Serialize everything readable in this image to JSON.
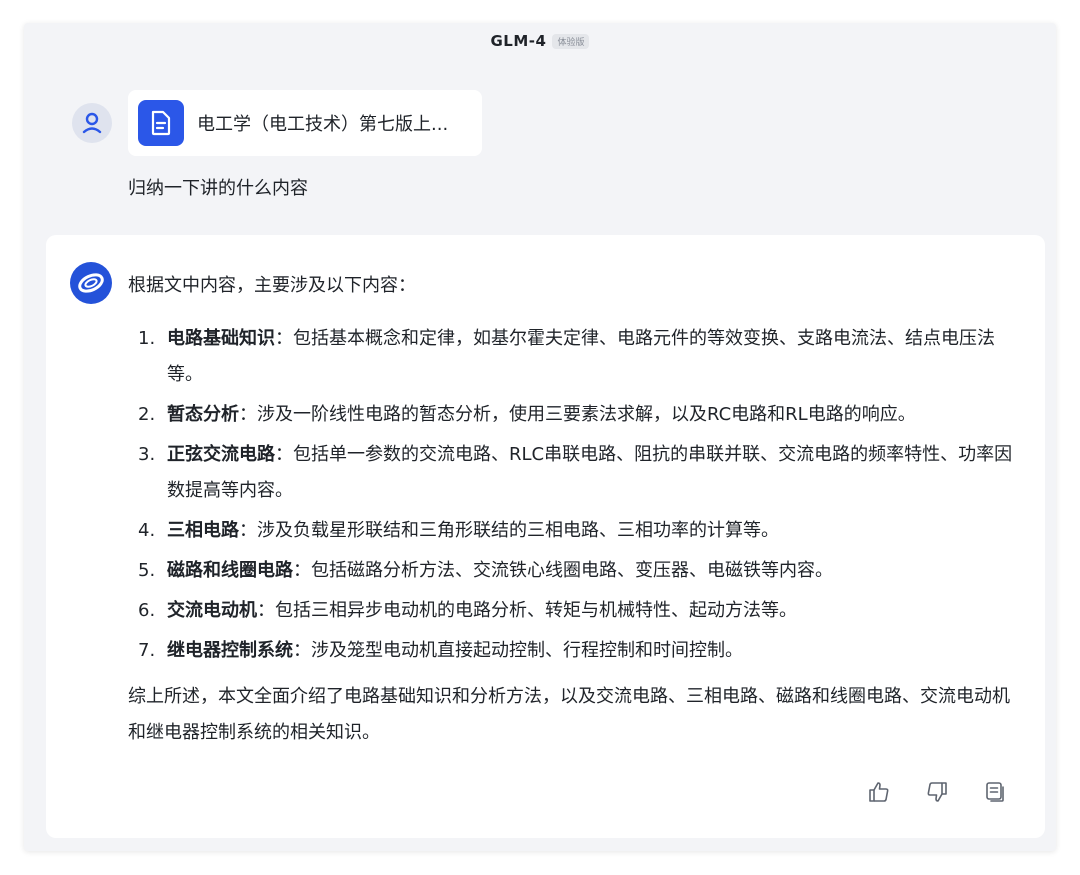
{
  "header": {
    "model_name": "GLM-4",
    "badge": "体验版"
  },
  "user_message": {
    "file_name": "电工学（电工技术）第七版上...",
    "question": "归纳一下讲的什么内容"
  },
  "answer": {
    "intro": "根据文中内容，主要涉及以下内容：",
    "items": [
      {
        "number": "1.",
        "title": "电路基础知识",
        "text": "：包括基本概念和定律，如基尔霍夫定律、电路元件的等效变换、支路电流法、结点电压法等。"
      },
      {
        "number": "2.",
        "title": "暂态分析",
        "text": "：涉及一阶线性电路的暂态分析，使用三要素法求解，以及RC电路和RL电路的响应。"
      },
      {
        "number": "3.",
        "title": "正弦交流电路",
        "text": "：包括单一参数的交流电路、RLC串联电路、阻抗的串联并联、交流电路的频率特性、功率因数提高等内容。"
      },
      {
        "number": "4.",
        "title": "三相电路",
        "text": "：涉及负载星形联结和三角形联结的三相电路、三相功率的计算等。"
      },
      {
        "number": "5.",
        "title": "磁路和线圈电路",
        "text": "：包括磁路分析方法、交流铁心线圈电路、变压器、电磁铁等内容。"
      },
      {
        "number": "6.",
        "title": "交流电动机",
        "text": "：包括三相异步电动机的电路分析、转矩与机械特性、起动方法等。"
      },
      {
        "number": "7.",
        "title": "继电器控制系统",
        "text": "：涉及笼型电动机直接起动控制、行程控制和时间控制。"
      }
    ],
    "summary": "综上所述，本文全面介绍了电路基础知识和分析方法，以及交流电路、三相电路、磁路和线圈电路、交流电动机和继电器控制系统的相关知识。"
  },
  "icons": {
    "user_avatar": "user-icon",
    "file": "document-icon",
    "bot_avatar": "glm-logo-icon",
    "like": "thumbs-up-icon",
    "dislike": "thumbs-down-icon",
    "copy": "copy-icon"
  },
  "colors": {
    "accent": "#2b57e8",
    "background": "#f3f4f7",
    "card": "#ffffff",
    "text": "#1f2329"
  }
}
